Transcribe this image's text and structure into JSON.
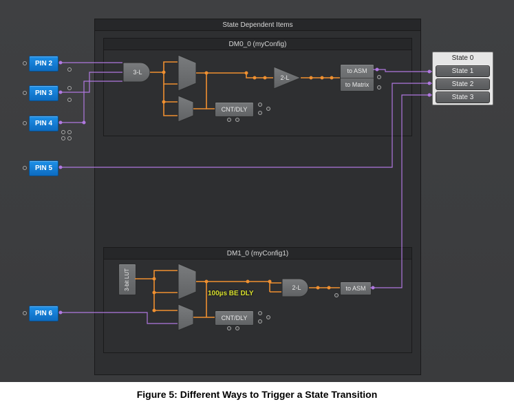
{
  "caption": "Figure 5: Different Ways to Trigger a State Transition",
  "outerPanel": {
    "title": "State Dependent Items"
  },
  "dm0": {
    "title": "DM0_0 (myConfig)"
  },
  "dm1": {
    "title": "DM1_0 (myConfig1)"
  },
  "pins": {
    "p2": "PIN 2",
    "p3": "PIN 3",
    "p4": "PIN 4",
    "p5": "PIN 5",
    "p6": "PIN 6"
  },
  "blocks": {
    "lut3a": "3-L",
    "cntdly": "CNT/DLY",
    "buf2l": "2-L",
    "toAsm": "to ASM",
    "toMatrix": "to Matrix",
    "lut3b": "3-bit LUT",
    "delayLabel": "100µs BE DLY",
    "and2l": "2-L"
  },
  "states": {
    "header": "State 0",
    "s1": "State 1",
    "s2": "State 2",
    "s3": "State 3"
  }
}
